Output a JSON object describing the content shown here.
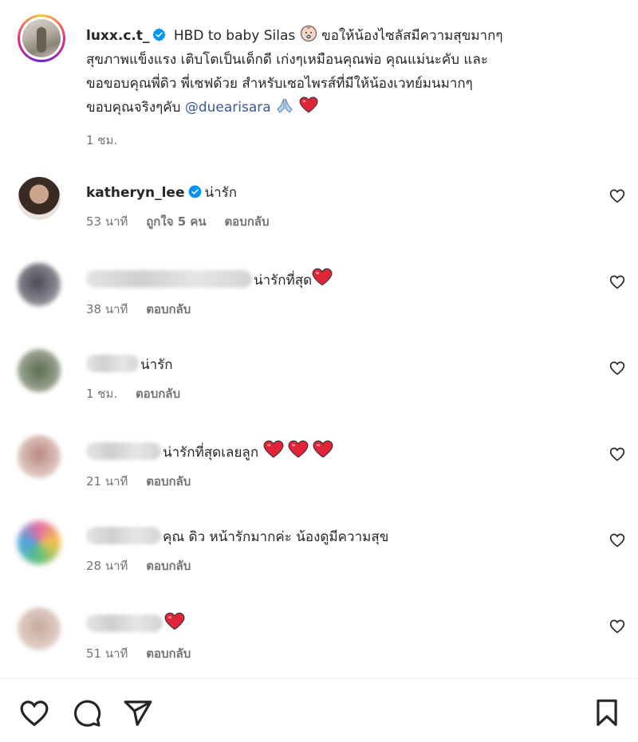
{
  "caption": {
    "username": "luxx.c.t_",
    "text_part1": " HBD to baby Silas ",
    "text_part2": " ขอให้น้องไซลัสมีความสุขมากๆ",
    "line2": "สุขภาพแข็งแรง เติบโตเป็นเด็กดี เก่งๆเหมือนคุณพ่อ คุณแม่นะคับ และ",
    "line3": "ขอขอบคุณพี่ดิว พี่เซฟด้วย สำหรับเซอไพรส์ที่มีให้น้องเวทย์มนมากๆ",
    "line4_prefix": "ขอบคุณจริงๆคับ ",
    "mention": "@duearisara",
    "time": "1 ชม."
  },
  "comments": [
    {
      "username": "katheryn_lee",
      "verified": true,
      "text": "น่ารัก",
      "time": "53 นาที",
      "likes": "ถูกใจ 5 คน",
      "reply": "ตอบกลับ"
    },
    {
      "text": "น่ารักที่สุด",
      "hearts": 1,
      "time": "38 นาที",
      "reply": "ตอบกลับ"
    },
    {
      "text": "น่ารัก",
      "time": "1 ชม.",
      "reply": "ตอบกลับ"
    },
    {
      "text": "น่ารักที่สุดเลยลูก ",
      "hearts": 3,
      "time": "21 นาที",
      "reply": "ตอบกลับ"
    },
    {
      "text": "คุณ ดิว หน้ารักมากค่ะ น้องดูมีความสุข",
      "time": "28 นาที",
      "reply": "ตอบกลับ"
    },
    {
      "text": "",
      "hearts": 1,
      "time": "51 นาที",
      "reply": "ตอบกลับ"
    }
  ],
  "colors": {
    "verified": "#0095f6",
    "heart_red": "#e0243a",
    "muted": "#737373",
    "mention": "#385898"
  },
  "icons": [
    "verified-badge-icon",
    "baby-emoji-icon",
    "pray-emoji-icon",
    "red-heart-emoji-icon",
    "like-heart-icon",
    "comment-icon",
    "share-icon",
    "bookmark-icon"
  ]
}
